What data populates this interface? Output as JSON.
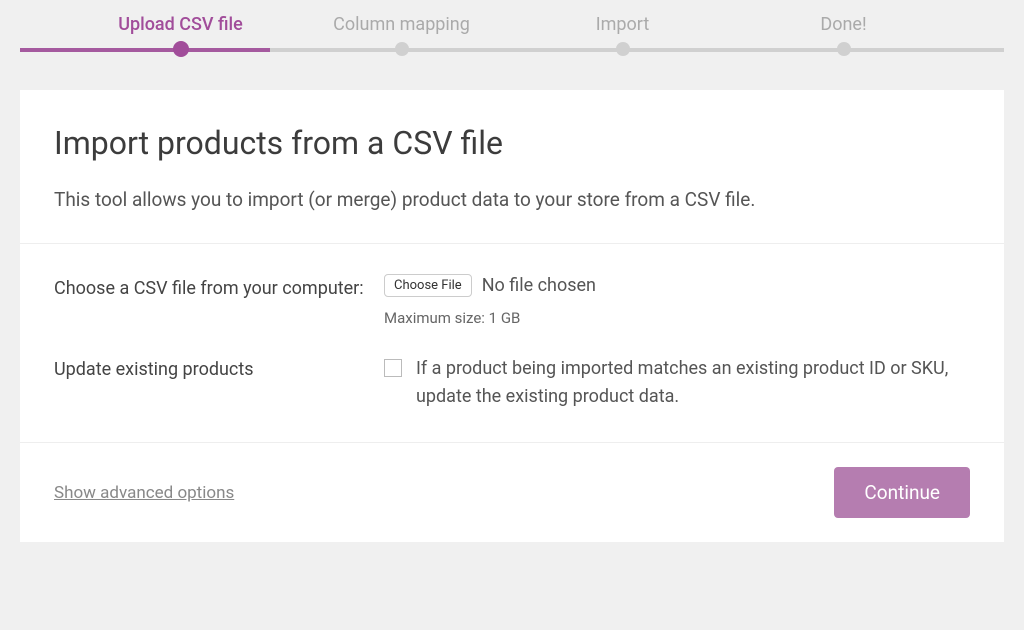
{
  "stepper": {
    "items": [
      {
        "label": "Upload CSV file",
        "active": true
      },
      {
        "label": "Column mapping",
        "active": false
      },
      {
        "label": "Import",
        "active": false
      },
      {
        "label": "Done!",
        "active": false
      }
    ]
  },
  "card": {
    "title": "Import products from a CSV file",
    "subtitle": "This tool allows you to import (or merge) product data to your store from a CSV file."
  },
  "form": {
    "file_label": "Choose a CSV file from your computer:",
    "choose_file_button": "Choose File",
    "file_status": "No file chosen",
    "file_hint": "Maximum size: 1 GB",
    "update_label": "Update existing products",
    "update_description": "If a product being imported matches an existing product ID or SKU, update the existing product data."
  },
  "footer": {
    "advanced_link": "Show advanced options",
    "continue_button": "Continue"
  }
}
